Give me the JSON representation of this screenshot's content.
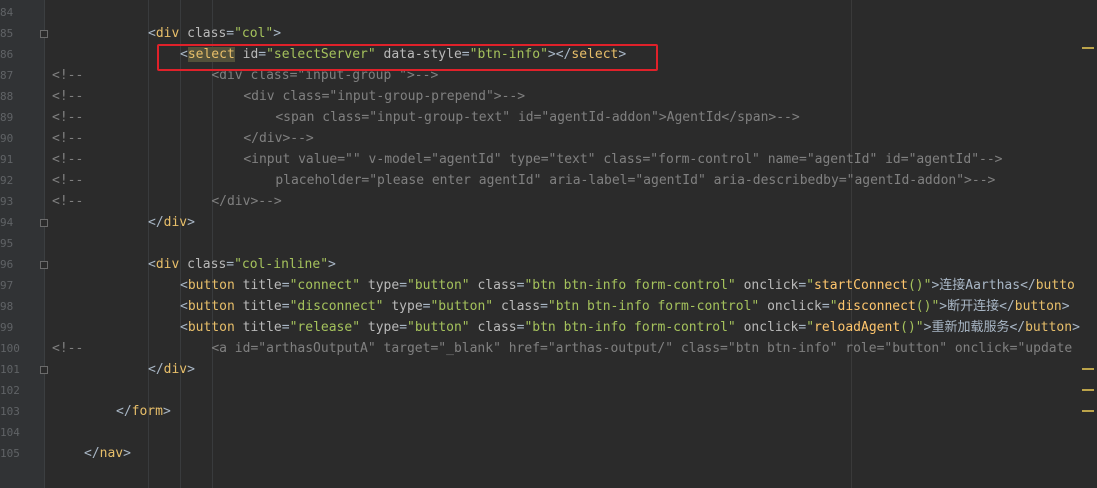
{
  "editor": {
    "line_numbers": [
      "84",
      "85",
      "86",
      "87",
      "88",
      "89",
      "90",
      "91",
      "92",
      "93",
      "94",
      "95",
      "96",
      "97",
      "98",
      "99",
      "100",
      "101",
      "102",
      "103",
      "104",
      "105"
    ],
    "lines": [
      {
        "prefix": "",
        "segs": []
      },
      {
        "prefix": "",
        "segs": [
          {
            "t": "text",
            "v": "<"
          },
          {
            "t": "tag",
            "v": "div"
          },
          {
            "t": "text",
            "v": " "
          },
          {
            "t": "attr",
            "v": "class"
          },
          {
            "t": "text",
            "v": "="
          },
          {
            "t": "val",
            "v": "\"col\""
          },
          {
            "t": "text",
            "v": ">"
          }
        ]
      },
      {
        "prefix": "",
        "segs": [
          {
            "t": "text",
            "v": "<"
          },
          {
            "t": "taghl",
            "v": "select"
          },
          {
            "t": "text",
            "v": " "
          },
          {
            "t": "attr",
            "v": "id"
          },
          {
            "t": "text",
            "v": "="
          },
          {
            "t": "val",
            "v": "\"selectServer\""
          },
          {
            "t": "text",
            "v": " "
          },
          {
            "t": "attr",
            "v": "data-style"
          },
          {
            "t": "text",
            "v": "="
          },
          {
            "t": "val",
            "v": "\"btn-info\""
          },
          {
            "t": "text",
            "v": "></"
          },
          {
            "t": "tag",
            "v": "select"
          },
          {
            "t": "text",
            "v": ">"
          }
        ]
      },
      {
        "prefix": "<!--",
        "segs": [
          {
            "t": "cmt",
            "v": "<div class=\"input-group \">-->"
          }
        ]
      },
      {
        "prefix": "<!--",
        "segs": [
          {
            "t": "cmt",
            "v": "<div class=\"input-group-prepend\">-->"
          }
        ]
      },
      {
        "prefix": "<!--",
        "segs": [
          {
            "t": "cmt",
            "v": "<span class=\"input-group-text\" id=\"agentId-addon\">AgentId</span>-->"
          }
        ]
      },
      {
        "prefix": "<!--",
        "segs": [
          {
            "t": "cmt",
            "v": "</div>-->"
          }
        ]
      },
      {
        "prefix": "<!--",
        "segs": [
          {
            "t": "cmt",
            "v": "<input value=\"\" v-model=\"agentId\" type=\"text\" class=\"form-control\" name=\"agentId\" id=\"agentId\"-->"
          }
        ]
      },
      {
        "prefix": "<!--",
        "segs": [
          {
            "t": "cmt",
            "v": "placeholder=\"please enter agentId\" aria-label=\"agentId\" aria-describedby=\"agentId-addon\">-->"
          }
        ]
      },
      {
        "prefix": "<!--",
        "segs": [
          {
            "t": "cmt",
            "v": "</div>-->"
          }
        ]
      },
      {
        "prefix": "",
        "segs": [
          {
            "t": "text",
            "v": "</"
          },
          {
            "t": "tag",
            "v": "div"
          },
          {
            "t": "text",
            "v": ">"
          }
        ]
      },
      {
        "prefix": "",
        "segs": []
      },
      {
        "prefix": "",
        "segs": [
          {
            "t": "text",
            "v": "<"
          },
          {
            "t": "tag",
            "v": "div"
          },
          {
            "t": "text",
            "v": " "
          },
          {
            "t": "attr",
            "v": "class"
          },
          {
            "t": "text",
            "v": "="
          },
          {
            "t": "val",
            "v": "\"col-inline\""
          },
          {
            "t": "text",
            "v": ">"
          }
        ]
      },
      {
        "prefix": "",
        "segs": [
          {
            "t": "text",
            "v": "<"
          },
          {
            "t": "tag",
            "v": "button"
          },
          {
            "t": "text",
            "v": " "
          },
          {
            "t": "attr",
            "v": "title"
          },
          {
            "t": "text",
            "v": "="
          },
          {
            "t": "val",
            "v": "\"connect\""
          },
          {
            "t": "text",
            "v": " "
          },
          {
            "t": "attr",
            "v": "type"
          },
          {
            "t": "text",
            "v": "="
          },
          {
            "t": "val",
            "v": "\"button\""
          },
          {
            "t": "text",
            "v": " "
          },
          {
            "t": "attr",
            "v": "class"
          },
          {
            "t": "text",
            "v": "="
          },
          {
            "t": "val",
            "v": "\"btn btn-info form-control\""
          },
          {
            "t": "text",
            "v": " "
          },
          {
            "t": "attr",
            "v": "onclick"
          },
          {
            "t": "text",
            "v": "="
          },
          {
            "t": "val",
            "v": "\""
          },
          {
            "t": "fn",
            "v": "startConnect"
          },
          {
            "t": "val",
            "v": "()\""
          },
          {
            "t": "text",
            "v": ">连接Aarthas</"
          },
          {
            "t": "tag",
            "v": "butto"
          }
        ]
      },
      {
        "prefix": "",
        "segs": [
          {
            "t": "text",
            "v": "<"
          },
          {
            "t": "tag",
            "v": "button"
          },
          {
            "t": "text",
            "v": " "
          },
          {
            "t": "attr",
            "v": "title"
          },
          {
            "t": "text",
            "v": "="
          },
          {
            "t": "val",
            "v": "\"disconnect\""
          },
          {
            "t": "text",
            "v": " "
          },
          {
            "t": "attr",
            "v": "type"
          },
          {
            "t": "text",
            "v": "="
          },
          {
            "t": "val",
            "v": "\"button\""
          },
          {
            "t": "text",
            "v": " "
          },
          {
            "t": "attr",
            "v": "class"
          },
          {
            "t": "text",
            "v": "="
          },
          {
            "t": "val",
            "v": "\"btn btn-info form-control\""
          },
          {
            "t": "text",
            "v": " "
          },
          {
            "t": "attr",
            "v": "onclick"
          },
          {
            "t": "text",
            "v": "="
          },
          {
            "t": "val",
            "v": "\""
          },
          {
            "t": "fn",
            "v": "disconnect"
          },
          {
            "t": "val",
            "v": "()\""
          },
          {
            "t": "text",
            "v": ">断开连接</"
          },
          {
            "t": "tag",
            "v": "button"
          },
          {
            "t": "text",
            "v": ">"
          }
        ]
      },
      {
        "prefix": "",
        "segs": [
          {
            "t": "text",
            "v": "<"
          },
          {
            "t": "tag",
            "v": "button"
          },
          {
            "t": "text",
            "v": " "
          },
          {
            "t": "attr",
            "v": "title"
          },
          {
            "t": "text",
            "v": "="
          },
          {
            "t": "val",
            "v": "\"release\""
          },
          {
            "t": "text",
            "v": " "
          },
          {
            "t": "attr",
            "v": "type"
          },
          {
            "t": "text",
            "v": "="
          },
          {
            "t": "val",
            "v": "\"button\""
          },
          {
            "t": "text",
            "v": " "
          },
          {
            "t": "attr",
            "v": "class"
          },
          {
            "t": "text",
            "v": "="
          },
          {
            "t": "val",
            "v": "\"btn btn-info form-control\""
          },
          {
            "t": "text",
            "v": " "
          },
          {
            "t": "attr",
            "v": "onclick"
          },
          {
            "t": "text",
            "v": "="
          },
          {
            "t": "val",
            "v": "\""
          },
          {
            "t": "fn",
            "v": "reloadAgent"
          },
          {
            "t": "val",
            "v": "()\""
          },
          {
            "t": "text",
            "v": ">重新加载服务</"
          },
          {
            "t": "tag",
            "v": "button"
          },
          {
            "t": "text",
            "v": ">"
          }
        ]
      },
      {
        "prefix": "<!--",
        "segs": [
          {
            "t": "cmt",
            "v": "<a id=\"arthasOutputA\" target=\"_blank\" href=\"arthas-output/\" class=\"btn btn-info\" role=\"button\" onclick=\"update"
          }
        ]
      },
      {
        "prefix": "",
        "segs": [
          {
            "t": "text",
            "v": "</"
          },
          {
            "t": "tag",
            "v": "div"
          },
          {
            "t": "text",
            "v": ">"
          }
        ]
      },
      {
        "prefix": "",
        "segs": []
      },
      {
        "prefix": "",
        "segs": [
          {
            "t": "text",
            "v": "</"
          },
          {
            "t": "tag",
            "v": "form"
          },
          {
            "t": "text",
            "v": ">"
          }
        ]
      },
      {
        "prefix": "",
        "segs": []
      },
      {
        "prefix": "",
        "segs": [
          {
            "t": "text",
            "v": "</"
          },
          {
            "t": "tag",
            "v": "nav"
          },
          {
            "t": "text",
            "v": ">"
          }
        ]
      }
    ]
  },
  "highlight": {
    "label": "selected-select-line",
    "color": "#e0212a"
  }
}
